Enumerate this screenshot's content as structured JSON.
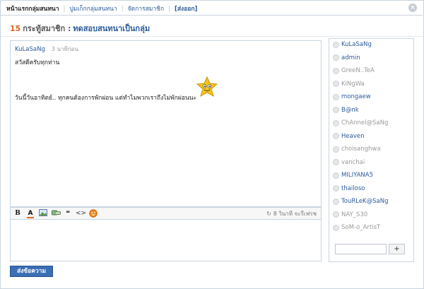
{
  "nav": {
    "home": "หน้าแรกกลุ่มสนทนา",
    "history": "ปูมเก็กกลุ่มสนทนา",
    "manage_members": "จัดการสมาชิก",
    "logout": "[ส่งออก]"
  },
  "close_label": "×",
  "title": {
    "count": "15",
    "label": "กระทู้สมาชิก :",
    "group_name": "ทดสอบสนทนาเป็นกลุ่ม"
  },
  "messages": [
    {
      "user": "KuLaSaNg",
      "time": "3 นาทีก่อน",
      "line1": "สวัสดีครับทุกท่าน",
      "line2": "วันนี้วันอาทิตย์.. ทุกคนต้องการพักผ่อน แต่ทำไมพวกเราถึงไม่พักผ่อนนะ"
    }
  ],
  "editor": {
    "toolbar": {
      "bold": "B",
      "color": "A",
      "quote": "❝",
      "code": "<>"
    },
    "autosave_icon": "↻",
    "autosave_text": "8 วินาที จะรีเฟรช",
    "input_value": ""
  },
  "send_label": "ส่งข้อความ",
  "members": [
    {
      "name": "KuLaSaNg",
      "online": true
    },
    {
      "name": "admin",
      "online": true
    },
    {
      "name": "GreeN..TeA",
      "online": false
    },
    {
      "name": "KiNgWa",
      "online": false
    },
    {
      "name": "mongaew",
      "online": true
    },
    {
      "name": "B@nk",
      "online": true
    },
    {
      "name": "ChAnnel@SaNg",
      "online": false
    },
    {
      "name": "Heaven",
      "online": true
    },
    {
      "name": "choisanghwa",
      "online": false
    },
    {
      "name": "vanchai",
      "online": false
    },
    {
      "name": "MILIYANA5",
      "online": true
    },
    {
      "name": "thailoso",
      "online": true
    },
    {
      "name": "TouRLeK@SaNg",
      "online": true
    },
    {
      "name": "NAY_S30",
      "online": false
    },
    {
      "name": "SoM-o_ArtisT",
      "online": false
    }
  ],
  "invite": {
    "input_value": "",
    "button_label": "+"
  },
  "colors": {
    "accent_blue": "#2a5a99",
    "count_orange": "#e0651a",
    "button_blue": "#3a6eb5",
    "border": "#c9d4de"
  }
}
